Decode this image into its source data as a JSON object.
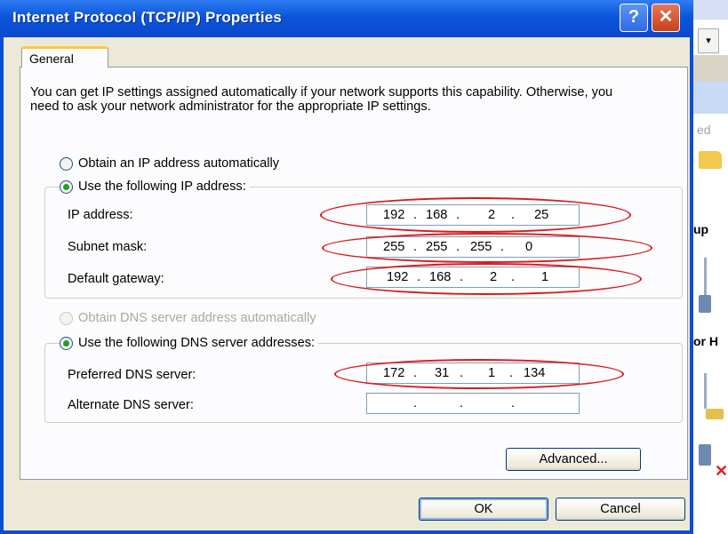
{
  "dialog": {
    "title": "Internet Protocol (TCP/IP) Properties",
    "help_label": "?",
    "close_label": "✕"
  },
  "tabs": [
    {
      "label": "General",
      "selected": true
    }
  ],
  "description": "You can get IP settings assigned automatically if your network supports this capability. Otherwise, you need to ask your network administrator for the appropriate IP settings.",
  "ip_section": {
    "auto_label": "Obtain an IP address automatically",
    "auto_selected": false,
    "manual_label": "Use the following IP address:",
    "manual_selected": true,
    "fields": [
      {
        "label": "IP address:",
        "octets": [
          "192",
          "168",
          "2",
          "25"
        ]
      },
      {
        "label": "Subnet mask:",
        "octets": [
          "255",
          "255",
          "255",
          "0"
        ]
      },
      {
        "label": "Default gateway:",
        "octets": [
          "192",
          "168",
          "2",
          "1"
        ]
      }
    ]
  },
  "dns_section": {
    "auto_label": "Obtain DNS server address automatically",
    "auto_enabled": false,
    "manual_label": "Use the following DNS server addresses:",
    "manual_selected": true,
    "fields": [
      {
        "label": "Preferred DNS server:",
        "octets": [
          "172",
          "31",
          "1",
          "134"
        ]
      },
      {
        "label": "Alternate DNS server:",
        "octets": [
          "",
          "",
          "",
          ""
        ]
      }
    ]
  },
  "buttons": {
    "advanced": "Advanced...",
    "ok": "OK",
    "cancel": "Cancel"
  },
  "background_window": {
    "text_fragment": "ed",
    "heading1": "up",
    "heading2": "or H",
    "dropdown_icon": "▾"
  },
  "colors": {
    "titlebar": "#0b55d9",
    "annotation": "#d81b1b",
    "radio_dot": "#21a121"
  },
  "icons": [
    "help-icon",
    "close-icon",
    "folder-icon",
    "network-device-icon",
    "error-x-icon"
  ]
}
